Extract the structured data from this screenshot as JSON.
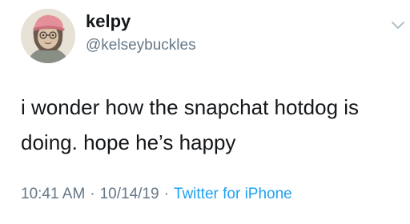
{
  "tweet": {
    "display_name": "kelpy",
    "handle": "@kelseybuckles",
    "text_line1": "i wonder how the snapchat hotdog is",
    "text_line2": "doing. hope he’s happy",
    "time": "10:41 AM",
    "date": "10/14/19",
    "separator": "·",
    "source": "Twitter for iPhone"
  },
  "icons": {
    "avatar": "profile-avatar",
    "menu": "chevron-down-icon"
  },
  "colors": {
    "text": "#14171a",
    "secondary": "#657786",
    "link": "#1da1f2",
    "background": "#ffffff"
  }
}
